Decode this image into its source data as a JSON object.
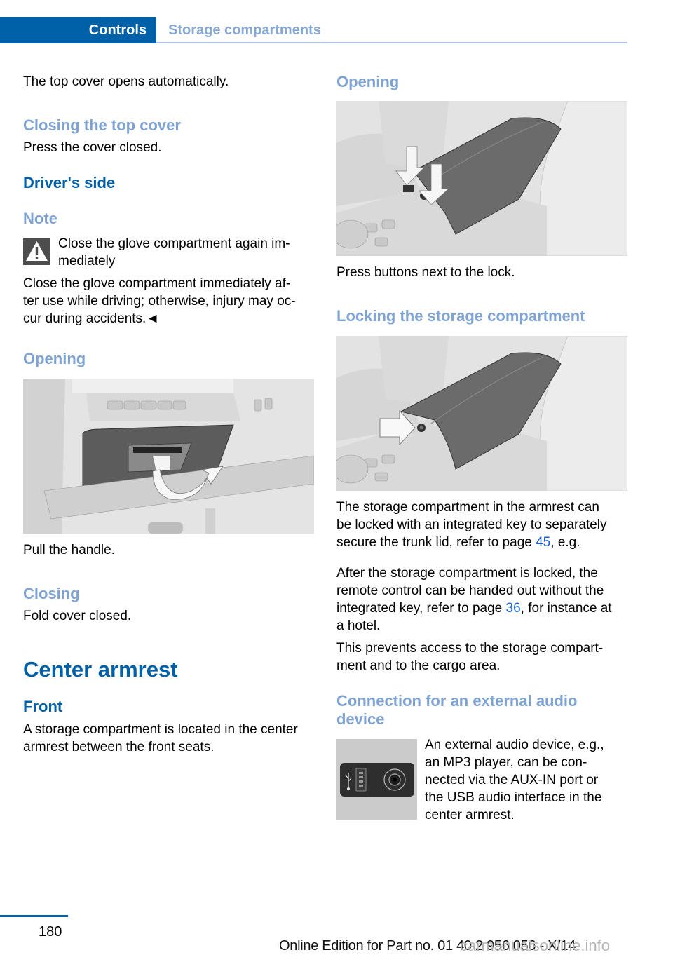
{
  "header": {
    "chapter": "Controls",
    "section": "Storage compartments",
    "accent_color": "#0060a8"
  },
  "left_column": {
    "intro": "The top cover opens automatically.",
    "closing_top_cover": {
      "heading": "Closing the top cover",
      "text": "Press the cover closed."
    },
    "drivers_side": {
      "heading": "Driver's side"
    },
    "note": {
      "heading": "Note",
      "icon": "warning-triangle-icon",
      "title_line1": "Close the glove compartment again im-",
      "title_line2": "mediately",
      "body_line1": "Close the glove compartment immediately af-",
      "body_line2": "ter use while driving; otherwise, injury may oc-",
      "body_line3": "cur during accidents.◄"
    },
    "opening": {
      "heading": "Opening",
      "figure_alt": "Glove compartment with arrow indicating pulling the handle",
      "caption": "Pull the handle."
    },
    "closing": {
      "heading": "Closing",
      "text": "Fold cover closed."
    },
    "center_armrest": {
      "heading": "Center armrest",
      "front_heading": "Front",
      "front_line1": "A storage compartment is located in the center",
      "front_line2": "armrest between the front seats."
    }
  },
  "right_column": {
    "opening": {
      "heading": "Opening",
      "figure_alt": "Center armrest with arrows pointing to buttons next to the lock",
      "caption": "Press buttons next to the lock."
    },
    "locking": {
      "heading": "Locking the storage compartment",
      "figure_alt": "Center armrest with arrow pointing to lock",
      "p1_line1": "The storage compartment in the armrest can",
      "p1_line2": "be locked with an integrated key to separately",
      "p1_line3_pre": "secure the trunk lid, refer to page ",
      "p1_link": "45",
      "p1_line3_post": ", e.g.",
      "p2_line1": "After the storage compartment is locked, the",
      "p2_line2": "remote control can be handed out without the",
      "p2_line3_pre": "integrated key, refer to page ",
      "p2_link": "36",
      "p2_line3_post": ", for instance at",
      "p2_line4": "a hotel.",
      "p3_line1": "This prevents access to the storage compart-",
      "p3_line2": "ment and to the cargo area."
    },
    "audio": {
      "heading_line1": "Connection for an external audio",
      "heading_line2": "device",
      "figure_alt": "USB port and AUX-IN jack",
      "aux_label": "AUX-IN",
      "text_line1": "An external audio device, e.g.,",
      "text_line2": "an MP3 player, can be con-",
      "text_line3": "nected via the AUX-IN port or",
      "text_line4": "the USB audio interface in the",
      "text_line5": "center armrest."
    }
  },
  "footer": {
    "page_number": "180",
    "edition": "Online Edition for Part no. 01 40 2 956 056 - X/14",
    "watermark": "carmanualsonline.info"
  }
}
